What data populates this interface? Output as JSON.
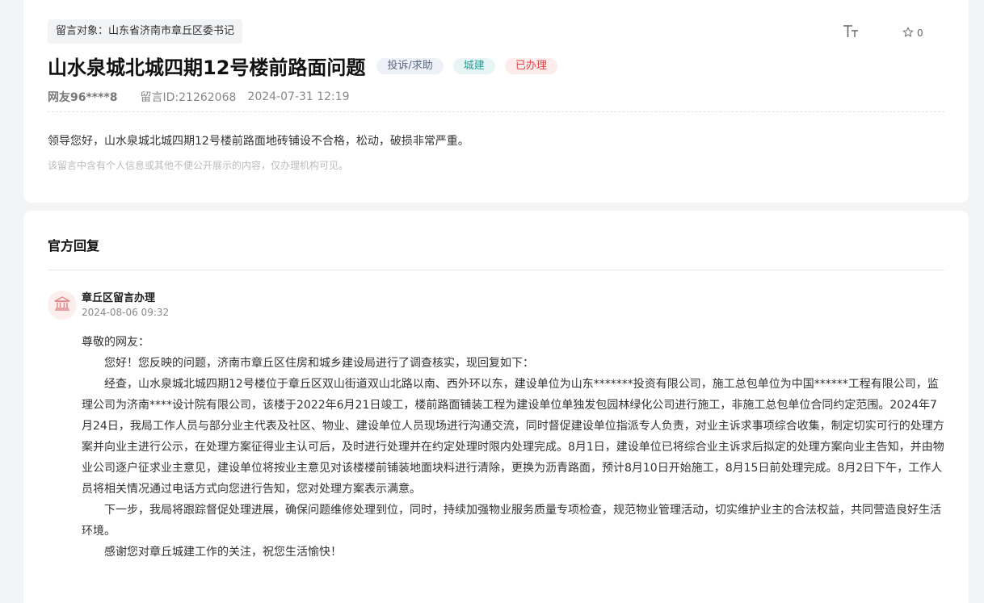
{
  "message": {
    "target_label": "留言对象：山东省济南市章丘区委书记",
    "title": "山水泉城北城四期12号楼前路面问题",
    "tags": {
      "type": "投诉/求助",
      "category": "城建",
      "status": "已办理"
    },
    "favorite_count": "0",
    "author": "网友96****8",
    "message_id": "留言ID:21262068",
    "date": "2024-07-31 12:19",
    "content": "领导您好，山水泉城北城四期12号楼前路面地砖铺设不合格，松动，破损非常严重。",
    "privacy_note": "该留言中含有个人信息或其他不便公开展示的内容，仅办理机构可见。"
  },
  "reply": {
    "heading": "官方回复",
    "org": "章丘区留言办理",
    "time": "2024-08-06 09:32",
    "greeting": "尊敬的网友：",
    "para1": "您好！您反映的问题，济南市章丘区住房和城乡建设局进行了调查核实，现回复如下：",
    "para2": "经查，山水泉城北城四期12号楼位于章丘区双山街道双山北路以南、西外环以东，建设单位为山东*******投资有限公司，施工总包单位为中国******工程有限公司，监理公司为济南****设计院有限公司，该楼于2022年6月21日竣工，楼前路面铺装工程为建设单位单独发包园林绿化公司进行施工，非施工总包单位合同约定范围。2024年7月24日，我局工作人员与部分业主代表及社区、物业、建设单位人员现场进行沟通交流，同时督促建设单位指派专人负责，对业主诉求事项综合收集，制定切实可行的处理方案并向业主进行公示，在处理方案征得业主认可后，及时进行处理并在约定处理时限内处理完成。8月1日，建设单位已将综合业主诉求后拟定的处理方案向业主告知，并由物业公司逐户征求业主意见，建设单位将按业主意见对该楼楼前铺装地面块料进行清除，更换为沥青路面，预计8月10日开始施工，8月15日前处理完成。8月2日下午，工作人员将相关情况通过电话方式向您进行告知，您对处理方案表示满意。",
    "para3": "下一步，我局将跟踪督促处理进展，确保问题维修处理到位，同时，持续加强物业服务质量专项检查，规范物业管理活动，切实维护业主的合法权益，共同营造良好生活环境。",
    "para4": "感谢您对章丘城建工作的关注，祝您生活愉快！"
  },
  "icons": {
    "font_size": "font-size-icon",
    "favorite": "star-icon",
    "org_avatar": "government-building-icon"
  },
  "colors": {
    "status_red": "#e0444a",
    "category_teal": "#2b9b93",
    "avatar_bg": "#fdeeee",
    "avatar_icon": "#e0888a"
  }
}
